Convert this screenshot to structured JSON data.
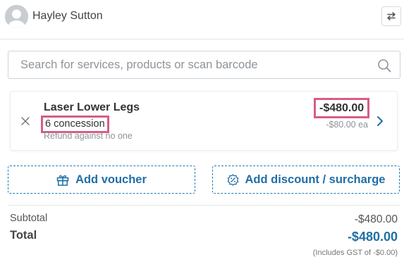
{
  "customer": {
    "name": "Hayley Sutton"
  },
  "search": {
    "placeholder": "Search for services, products or scan barcode",
    "value": ""
  },
  "line_item": {
    "name": "Laser Lower Legs",
    "quantity_text": "6 concession",
    "note": "Refund against no one",
    "total": "-$480.00",
    "unit_price": "-$80.00 ea"
  },
  "actions": {
    "voucher_label": "Add voucher",
    "discount_label": "Add discount / surcharge"
  },
  "summary": {
    "subtotal_label": "Subtotal",
    "subtotal_value": "-$480.00",
    "total_label": "Total",
    "total_value": "-$480.00",
    "gst_note": "(Includes GST of -$0.00)"
  },
  "colors": {
    "accent": "#1f6fa6",
    "highlight_border": "#d95c86"
  },
  "icons": {
    "avatar": "user-avatar-icon",
    "swap": "swap-arrows-icon",
    "search": "search-icon",
    "remove": "close-icon",
    "chevron": "chevron-right-icon",
    "voucher": "gift-icon",
    "discount": "percent-badge-icon"
  }
}
